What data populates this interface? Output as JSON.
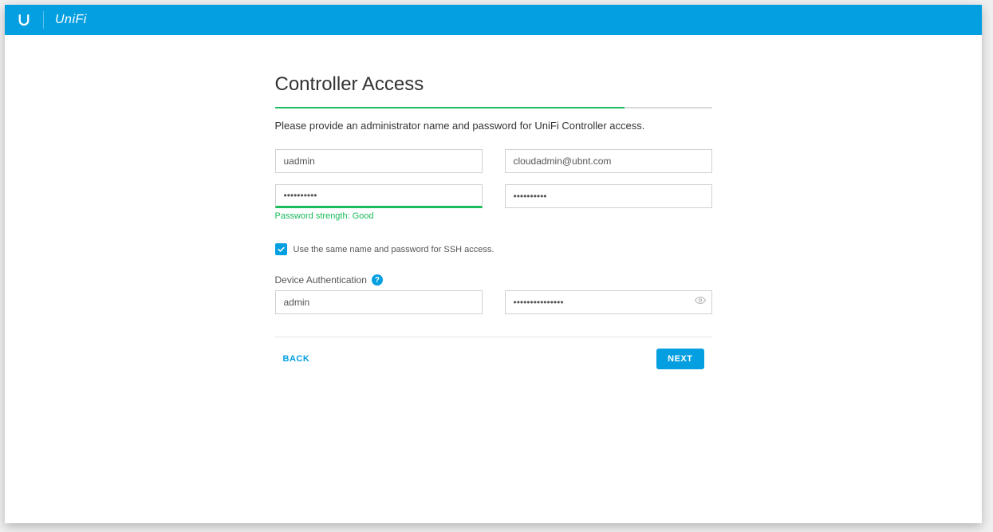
{
  "header": {
    "brand": "UniFi"
  },
  "page": {
    "title": "Controller Access",
    "instruction": "Please provide an administrator name and password for UniFi Controller access.",
    "progress_percent": 80
  },
  "form": {
    "admin_name": "uadmin",
    "admin_email": "cloudadmin@ubnt.com",
    "password": "••••••••••",
    "password_confirm": "••••••••••",
    "strength_prefix": "Password strength: ",
    "strength_value": "Good",
    "ssh_checkbox_label": "Use the same name and password for SSH access.",
    "ssh_checked": true,
    "device_auth_label": "Device Authentication",
    "device_user": "admin",
    "device_pass": "•••••••••••••••"
  },
  "footer": {
    "back": "BACK",
    "next": "NEXT"
  }
}
